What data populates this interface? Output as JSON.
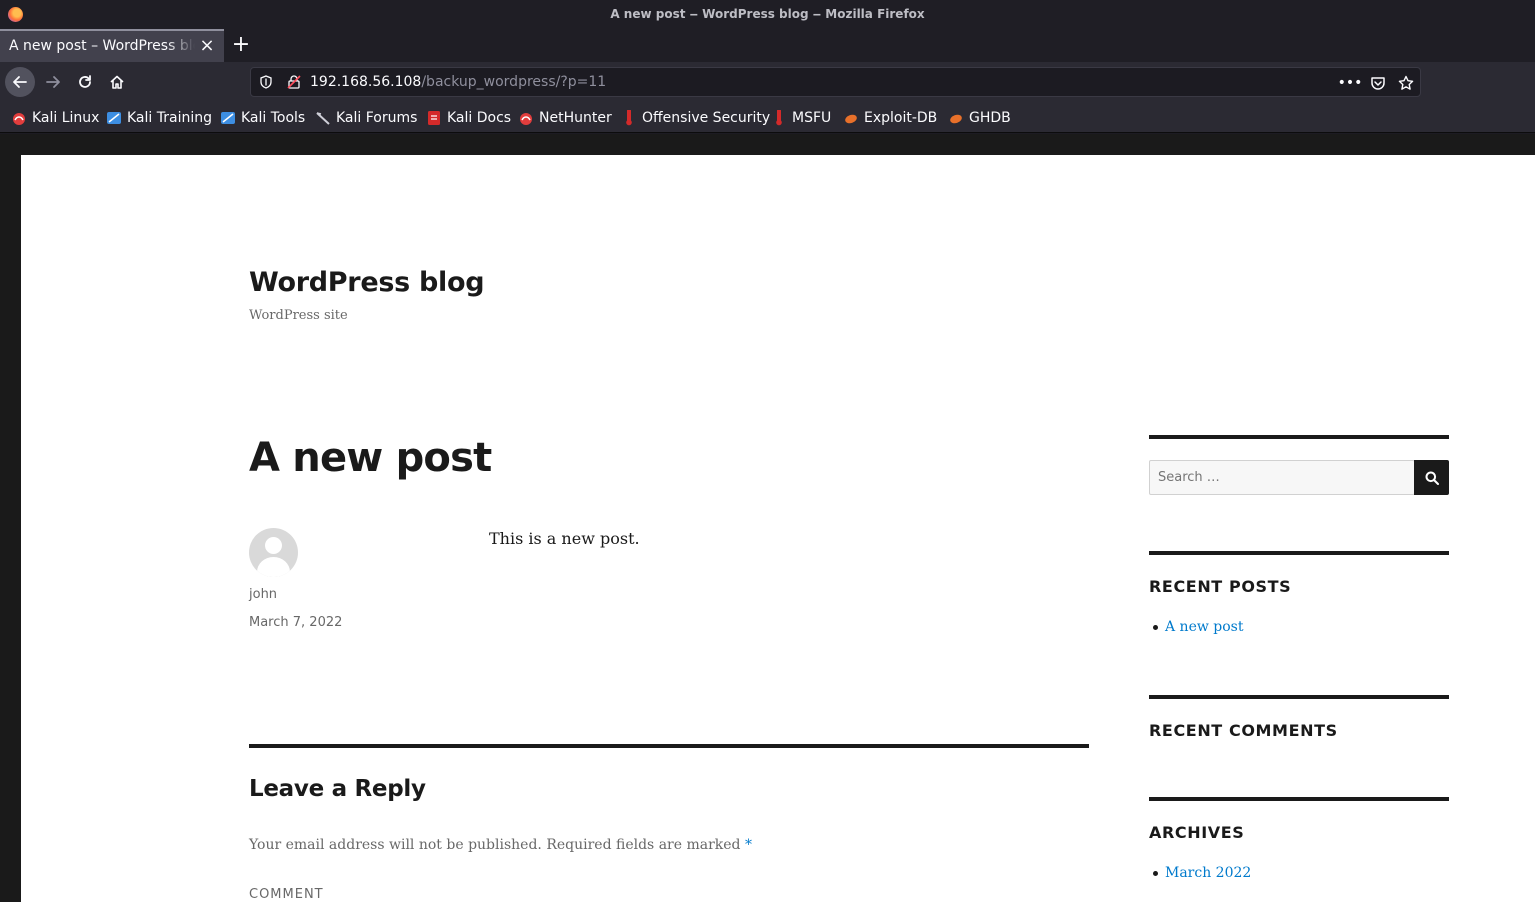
{
  "window": {
    "title": "A new post ‒ WordPress blog ‒ Mozilla Firefox"
  },
  "tabs": [
    {
      "label": "A new post – WordPress blog",
      "active": true
    }
  ],
  "navbar": {
    "url_host": "192.168.56.108",
    "url_path": "/backup_wordpress/?p=11"
  },
  "bookmarks": [
    {
      "label": "Kali Linux",
      "icon": "kali-icon"
    },
    {
      "label": "Kali Training",
      "icon": "kali-training-icon"
    },
    {
      "label": "Kali Tools",
      "icon": "kali-tools-icon"
    },
    {
      "label": "Kali Forums",
      "icon": "kali-forums-icon"
    },
    {
      "label": "Kali Docs",
      "icon": "kali-docs-icon"
    },
    {
      "label": "NetHunter",
      "icon": "nethunter-icon"
    },
    {
      "label": "Offensive Security",
      "icon": "offsec-icon"
    },
    {
      "label": "MSFU",
      "icon": "msfu-icon"
    },
    {
      "label": "Exploit-DB",
      "icon": "exploitdb-icon"
    },
    {
      "label": "GHDB",
      "icon": "ghdb-icon"
    }
  ],
  "site": {
    "title": "WordPress blog",
    "description": "WordPress site"
  },
  "post": {
    "title": "A new post",
    "author": "john",
    "date": "March 7, 2022",
    "content": "This is a new post."
  },
  "reply": {
    "title": "Leave a Reply",
    "note": "Your email address will not be published. Required fields are marked",
    "required_mark": "*",
    "comment_label": "COMMENT"
  },
  "sidebar": {
    "search_placeholder": "Search …",
    "recent_posts": {
      "title": "RECENT POSTS",
      "items": [
        "A new post"
      ]
    },
    "recent_comments": {
      "title": "RECENT COMMENTS",
      "items": []
    },
    "archives": {
      "title": "ARCHIVES",
      "items": [
        "March 2022"
      ]
    }
  },
  "colors": {
    "link": "#007acc",
    "text": "#1a1a1a",
    "muted": "#686868",
    "browser_chrome": "#2b2a33"
  }
}
